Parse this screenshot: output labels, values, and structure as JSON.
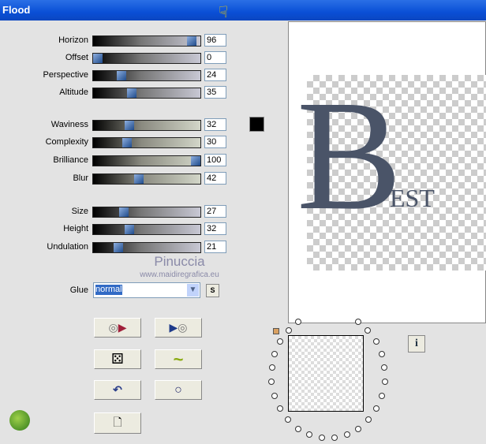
{
  "window": {
    "title": "Flood"
  },
  "params": [
    {
      "label": "Horizon",
      "value": "96",
      "pct": 96,
      "group": 1
    },
    {
      "label": "Offset",
      "value": "0",
      "pct": 0,
      "group": 1
    },
    {
      "label": "Perspective",
      "value": "24",
      "pct": 24,
      "group": 1
    },
    {
      "label": "Altitude",
      "value": "35",
      "pct": 35,
      "group": 1
    },
    {
      "label": "Waviness",
      "value": "32",
      "pct": 32,
      "group": 2
    },
    {
      "label": "Complexity",
      "value": "30",
      "pct": 30,
      "group": 2
    },
    {
      "label": "Brilliance",
      "value": "100",
      "pct": 100,
      "group": 2
    },
    {
      "label": "Blur",
      "value": "42",
      "pct": 42,
      "group": 2
    },
    {
      "label": "Size",
      "value": "27",
      "pct": 27,
      "group": 3
    },
    {
      "label": "Height",
      "value": "32",
      "pct": 32,
      "group": 3
    },
    {
      "label": "Undulation",
      "value": "21",
      "pct": 21,
      "group": 3
    }
  ],
  "color_swatch": "#000000",
  "watermark": {
    "name": "Pinuccia",
    "url": "www.maidiregrafica.eu"
  },
  "glue": {
    "label": "Glue",
    "value": "normal",
    "s_label": "S"
  },
  "preview": {
    "letter": "B",
    "suffix": "EST"
  },
  "buttons": [
    {
      "name": "load-preset-button",
      "icon": "disc-arrow-icon"
    },
    {
      "name": "save-preset-button",
      "icon": "arrow-disc-icon"
    },
    {
      "name": "randomize-button",
      "icon": "dice-icon"
    },
    {
      "name": "wave-button",
      "icon": "wave-icon"
    },
    {
      "name": "undo-button",
      "icon": "undo-icon"
    },
    {
      "name": "reset-button",
      "icon": "ring-icon"
    },
    {
      "name": "copy-button",
      "icon": "copy-icon"
    }
  ],
  "info_label": "i"
}
